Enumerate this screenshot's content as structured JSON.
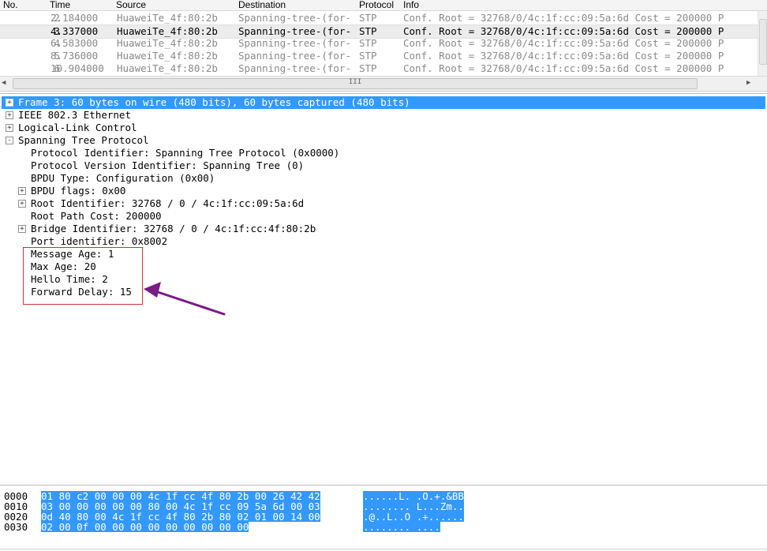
{
  "packet_list": {
    "columns": [
      "No.",
      "Time",
      "Source",
      "Destination",
      "Protocol",
      "Info"
    ],
    "rows": [
      {
        "no": "2",
        "time": "2.184000",
        "source": "HuaweiTe_4f:80:2b",
        "destination": "Spanning-tree-(for-",
        "protocol": "STP",
        "info": "Conf. Root = 32768/0/4c:1f:cc:09:5a:6d   Cost = 200000  P",
        "selected": false
      },
      {
        "no": "3",
        "time": "4.337000",
        "source": "HuaweiTe_4f:80:2b",
        "destination": "Spanning-tree-(for-",
        "protocol": "STP",
        "info": "Conf. Root = 32768/0/4c:1f:cc:09:5a:6d   Cost = 200000  P",
        "selected": true
      },
      {
        "no": "4",
        "time": "6.583000",
        "source": "HuaweiTe_4f:80:2b",
        "destination": "Spanning-tree-(for-",
        "protocol": "STP",
        "info": "Conf. Root = 32768/0/4c:1f:cc:09:5a:6d   Cost = 200000  P",
        "selected": false
      },
      {
        "no": "5",
        "time": "8.736000",
        "source": "HuaweiTe_4f:80:2b",
        "destination": "Spanning-tree-(for-",
        "protocol": "STP",
        "info": "Conf. Root = 32768/0/4c:1f:cc:09:5a:6d   Cost = 200000  P",
        "selected": false
      },
      {
        "no": "6",
        "time": "10.904000",
        "source": "HuaweiTe_4f:80:2b",
        "destination": "Spanning-tree-(for-",
        "protocol": "STP",
        "info": "Conf. Root = 32768/0/4c:1f:cc:09:5a:6d   Cost = 200000  P",
        "selected": false
      }
    ]
  },
  "scroll": {
    "left_arrow": "◀",
    "right_arrow": "▶",
    "grip": "III"
  },
  "details": {
    "rows": [
      {
        "text": "Frame 3: 60 bytes on wire (480 bits), 60 bytes captured (480 bits)",
        "indent": 0,
        "expander": "+",
        "selected": true
      },
      {
        "text": "IEEE 802.3 Ethernet",
        "indent": 0,
        "expander": "+",
        "selected": false
      },
      {
        "text": "Logical-Link Control",
        "indent": 0,
        "expander": "+",
        "selected": false
      },
      {
        "text": "Spanning Tree Protocol",
        "indent": 0,
        "expander": "-",
        "selected": false
      },
      {
        "text": "Protocol Identifier: Spanning Tree Protocol (0x0000)",
        "indent": 1,
        "expander": "",
        "selected": false
      },
      {
        "text": "Protocol Version Identifier: Spanning Tree (0)",
        "indent": 1,
        "expander": "",
        "selected": false
      },
      {
        "text": "BPDU Type: Configuration (0x00)",
        "indent": 1,
        "expander": "",
        "selected": false
      },
      {
        "text": "BPDU flags: 0x00",
        "indent": 1,
        "expander": "+",
        "selected": false
      },
      {
        "text": "Root Identifier: 32768 / 0 / 4c:1f:cc:09:5a:6d",
        "indent": 1,
        "expander": "+",
        "selected": false
      },
      {
        "text": "Root Path Cost: 200000",
        "indent": 1,
        "expander": "",
        "selected": false
      },
      {
        "text": "Bridge Identifier: 32768 / 0 / 4c:1f:cc:4f:80:2b",
        "indent": 1,
        "expander": "+",
        "selected": false
      },
      {
        "text": "Port identifier: 0x8002",
        "indent": 1,
        "expander": "",
        "selected": false
      },
      {
        "text": "Message Age: 1",
        "indent": 1,
        "expander": "",
        "selected": false
      },
      {
        "text": "Max Age: 20",
        "indent": 1,
        "expander": "",
        "selected": false
      },
      {
        "text": "Hello Time: 2",
        "indent": 1,
        "expander": "",
        "selected": false
      },
      {
        "text": "Forward Delay: 15",
        "indent": 1,
        "expander": "",
        "selected": false
      }
    ]
  },
  "annotation": {
    "box_color": "#c8333a",
    "arrow_color": "#7a1b86"
  },
  "bytes": {
    "rows": [
      {
        "offset": "0000",
        "hex": "01 80 c2 00 00 00 4c 1f  cc 4f 80 2b 00 26 42 42",
        "ascii": "......L. .O.+.&BB"
      },
      {
        "offset": "0010",
        "hex": "03 00 00 00 00 00 80 00  4c 1f cc 09 5a 6d 00 03",
        "ascii": "........ L...Zm.."
      },
      {
        "offset": "0020",
        "hex": "0d 40 80 00 4c 1f cc 4f  80 2b 80 02 01 00 14 00",
        "ascii": ".@..L..O .+......"
      },
      {
        "offset": "0030",
        "hex": "02 00 0f 00 00 00 00 00  00 00 00 00",
        "ascii": "........ ...."
      }
    ]
  },
  "colors": {
    "selection": "#3399ff",
    "dim_text": "#8a8a8a"
  }
}
